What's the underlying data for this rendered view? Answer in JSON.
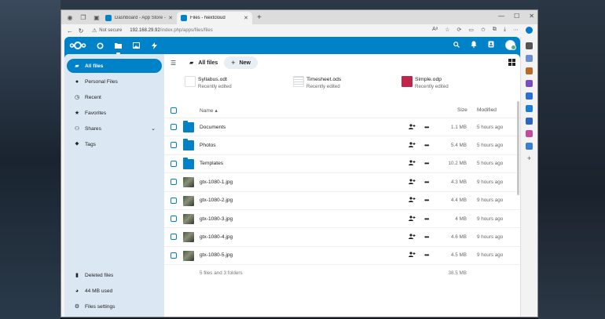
{
  "browser": {
    "tabs": [
      {
        "label": "Dashboard - App Store - Nextcl",
        "active": false
      },
      {
        "label": "Files - Nextcloud",
        "active": true
      }
    ],
    "not_secure": "Not secure",
    "url_host": "192.168.29.92",
    "url_path": "/index.php/apps/files/files"
  },
  "header": {
    "icons": [
      "nextcloud-logo",
      "dashboard-icon",
      "files-icon",
      "photos-icon",
      "activity-icon"
    ],
    "accent": "#0082c9"
  },
  "sidebar": {
    "items": [
      {
        "label": "All files",
        "icon": "folder-icon",
        "active": true
      },
      {
        "label": "Personal Files",
        "icon": "person-icon",
        "active": false
      },
      {
        "label": "Recent",
        "icon": "clock-icon",
        "active": false
      },
      {
        "label": "Favorites",
        "icon": "star-icon",
        "active": false
      },
      {
        "label": "Shares",
        "icon": "share-icon",
        "active": false
      },
      {
        "label": "Tags",
        "icon": "tag-icon",
        "active": false
      }
    ],
    "bottom": [
      {
        "label": "Deleted files",
        "icon": "trash-icon"
      },
      {
        "label": "44 MB used",
        "icon": "pie-icon"
      },
      {
        "label": "Files settings",
        "icon": "gear-icon"
      }
    ]
  },
  "main": {
    "breadcrumb": "All files",
    "new_label": "New",
    "recent": [
      {
        "name": "Syllabus.odt",
        "sub": "Recently edited",
        "type": "odt"
      },
      {
        "name": "Timesheet.ods",
        "sub": "Recently edited",
        "type": "ods"
      },
      {
        "name": "Simple.odp",
        "sub": "Recently edited",
        "type": "odp"
      }
    ],
    "columns": {
      "name": "Name",
      "size": "Size",
      "modified": "Modified"
    },
    "files": [
      {
        "name": "Documents",
        "type": "folder",
        "size": "1.1 MB",
        "modified": "5 hours ago"
      },
      {
        "name": "Photos",
        "type": "folder",
        "size": "5.4 MB",
        "modified": "5 hours ago"
      },
      {
        "name": "Templates",
        "type": "folder",
        "size": "10.2 MB",
        "modified": "5 hours ago"
      },
      {
        "name": "gtx-1080-1.jpg",
        "type": "image",
        "size": "4.3 MB",
        "modified": "9 hours ago"
      },
      {
        "name": "gtx-1080-2.jpg",
        "type": "image",
        "size": "4.4 MB",
        "modified": "9 hours ago"
      },
      {
        "name": "gtx-1080-3.jpg",
        "type": "image",
        "size": "4 MB",
        "modified": "9 hours ago"
      },
      {
        "name": "gtx-1080-4.jpg",
        "type": "image",
        "size": "4.6 MB",
        "modified": "9 hours ago"
      },
      {
        "name": "gtx-1080-5.jpg",
        "type": "image",
        "size": "4.5 MB",
        "modified": "9 hours ago"
      }
    ],
    "summary": {
      "text": "5 files and 3 folders",
      "size": "38.5 MB"
    }
  }
}
